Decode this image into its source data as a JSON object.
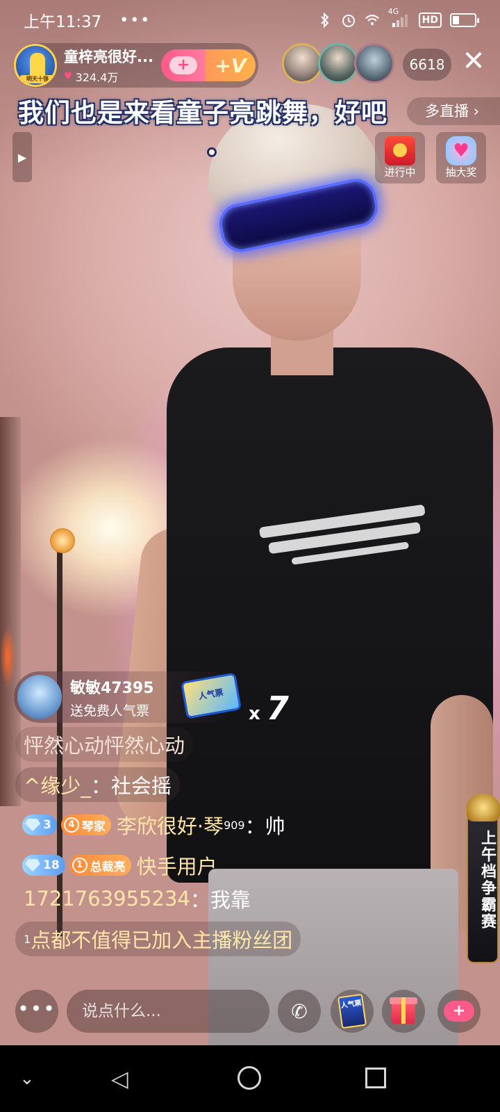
{
  "status_bar": {
    "time": "上午11:37",
    "dots": "•••",
    "network": "4G",
    "hd": "HD",
    "battery_level": 0.3
  },
  "host": {
    "name": "童梓亮很好...",
    "likes": "324.4万",
    "avatar_tag": "明天十强",
    "follow_icon": "+",
    "vip_label": "+V"
  },
  "viewers": {
    "count": "6618"
  },
  "close_label": "✕",
  "more_live_label": "多直播 ›",
  "caption": "我们也是来看童子亮跳舞，好吧",
  "side_expand_icon": "▶",
  "widgets": {
    "progress_label": "进行中",
    "lottery_label": "抽大奖"
  },
  "gift": {
    "user": "敏敏47395",
    "action": "送免费人气票",
    "ticket_label": "人气票",
    "count_prefix": "x",
    "count": "7"
  },
  "chat": [
    {
      "type": "system",
      "text": "怦然心动怦然心动"
    },
    {
      "type": "message",
      "user": "^缘少_",
      "sep": "：",
      "text": "社会摇"
    },
    {
      "type": "message",
      "level": "3",
      "fan_num": "4",
      "fan_label": "琴家",
      "user": "李欣很好·琴",
      "user_sup": "909",
      "sep": "：",
      "text": "帅"
    },
    {
      "type": "join",
      "level": "18",
      "fan_num": "1",
      "fan_label": "总裁亮",
      "user": "快手用户"
    },
    {
      "type": "message",
      "user": "1721763955234",
      "sep": "：",
      "text": "我靠"
    },
    {
      "type": "system",
      "sup": "1",
      "text": "点都不值得已加入主播粉丝团"
    }
  ],
  "contest_label": "上午档争霸赛",
  "bottom_bar": {
    "more_label": "•••",
    "comment_placeholder": "说点什么...",
    "call_icon": "✆",
    "ticket_label": "人气票",
    "like_icon": "+"
  },
  "nav": {
    "collapse": "⌄",
    "back": "◁"
  },
  "icons": {
    "bluetooth": "bluetooth-icon",
    "alarm": "alarm-icon",
    "wifi": "wifi-icon",
    "signal": "signal-icon",
    "battery": "battery-icon"
  }
}
